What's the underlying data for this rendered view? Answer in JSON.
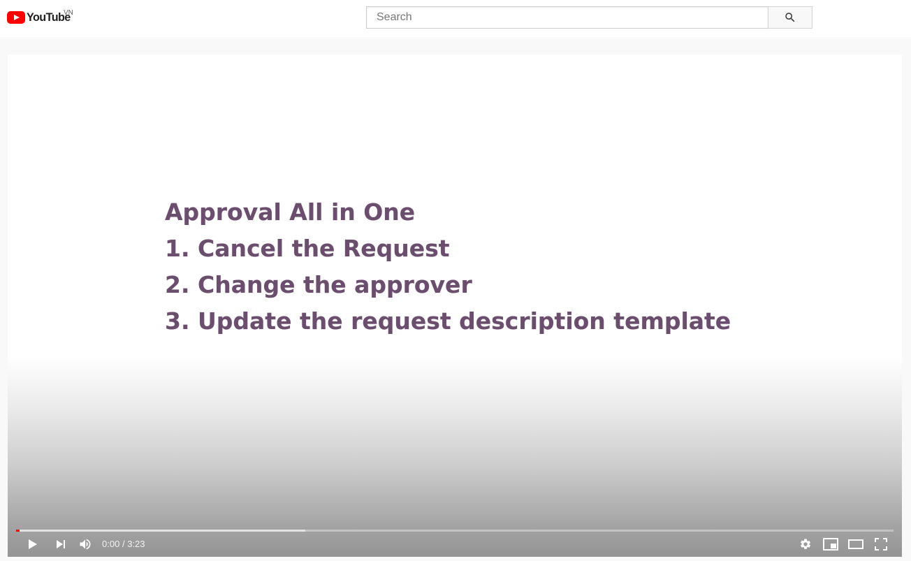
{
  "masthead": {
    "logo_text": "YouTube",
    "country_code": "VN",
    "search": {
      "placeholder": "Search",
      "value": ""
    },
    "icons": {
      "search_button": "search-icon"
    }
  },
  "video": {
    "slide_lines": [
      "Approval All in One",
      "1. Cancel the Request",
      "2. Change the approver",
      "3. Update the request description template"
    ],
    "current_time": "0:00",
    "time_separator": "/",
    "duration": "3:23",
    "played_fraction": 0.0,
    "buffered_fraction": 0.33
  },
  "controls": {
    "left": [
      "play-icon",
      "next-icon",
      "volume-icon"
    ],
    "right": [
      "settings-icon",
      "miniplayer-icon",
      "theater-mode-icon",
      "fullscreen-icon"
    ]
  },
  "colors": {
    "brand_red": "#ff0000",
    "slide_text": "#6b4e6e",
    "progress_played": "#ff0000"
  }
}
